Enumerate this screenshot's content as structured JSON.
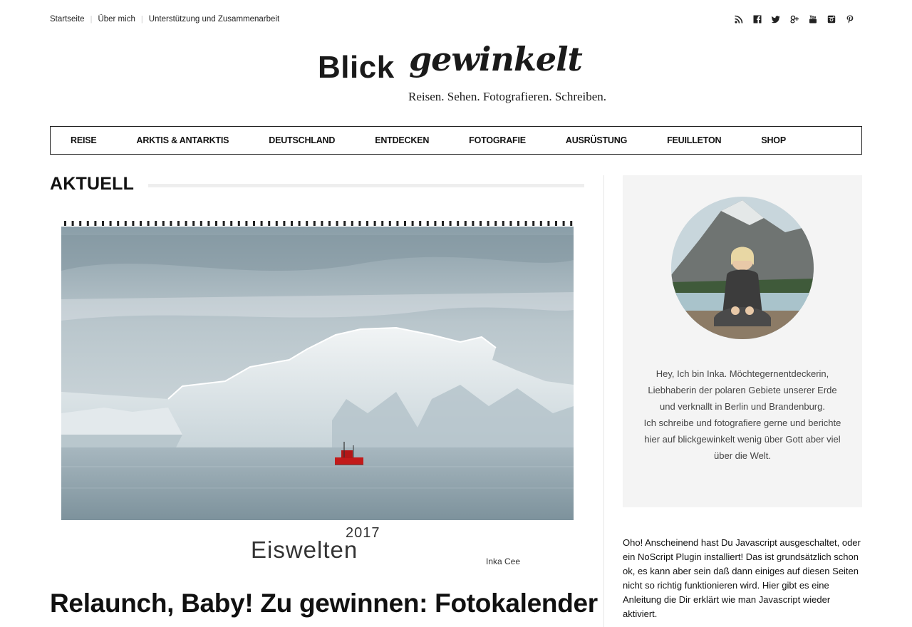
{
  "topnav": {
    "items": [
      "Startseite",
      "Über mich",
      "Unterstützung und Zusammenarbeit"
    ],
    "separator": "|"
  },
  "social_icons": [
    "rss-icon",
    "facebook-icon",
    "twitter-icon",
    "google-plus-icon",
    "youtube-icon",
    "instagram-icon",
    "pinterest-icon"
  ],
  "logo": {
    "main": "Blick",
    "script": "gewinkelt",
    "tagline": "Reisen. Sehen. Fotografieren. Schreiben."
  },
  "mainnav": {
    "items": [
      "REISE",
      "ARKTIS & ANTARKTIS",
      "DEUTSCHLAND",
      "ENTDECKEN",
      "FOTOGRAFIE",
      "AUSRÜSTUNG",
      "FEUILLETON",
      "SHOP"
    ]
  },
  "section": {
    "title": "AKTUELL"
  },
  "feature": {
    "calendar_year": "2017",
    "calendar_title": "Eiswelten",
    "calendar_author": "Inka Cee"
  },
  "post": {
    "title": "Relaunch, Baby! Zu gewinnen: Fotokalender"
  },
  "sidebar": {
    "about_p1": "Hey, Ich bin Inka. Möchtegernentdeckerin, Liebhaberin der polaren Gebiete unserer Erde und verknallt in Berlin und Brandenburg.",
    "about_p2": "Ich schreibe und fotografiere gerne und berichte hier auf blickgewinkelt wenig über Gott aber viel über die Welt.",
    "noscript": "Oho! Anscheinend hast Du Javascript ausgeschaltet, oder ein NoScript Plugin installiert! Das ist grundsätzlich schon ok, es kann aber sein daß dann einiges auf diesen Seiten nicht so richtig funktionieren wird. Hier gibt es eine Anleitung die Dir erklärt wie man Javascript wieder aktiviert."
  },
  "colors": {
    "accent_text": "#111111",
    "nav_border": "#222222",
    "sidebar_bg": "#f4f4f4",
    "section_line": "#eeeeee"
  }
}
